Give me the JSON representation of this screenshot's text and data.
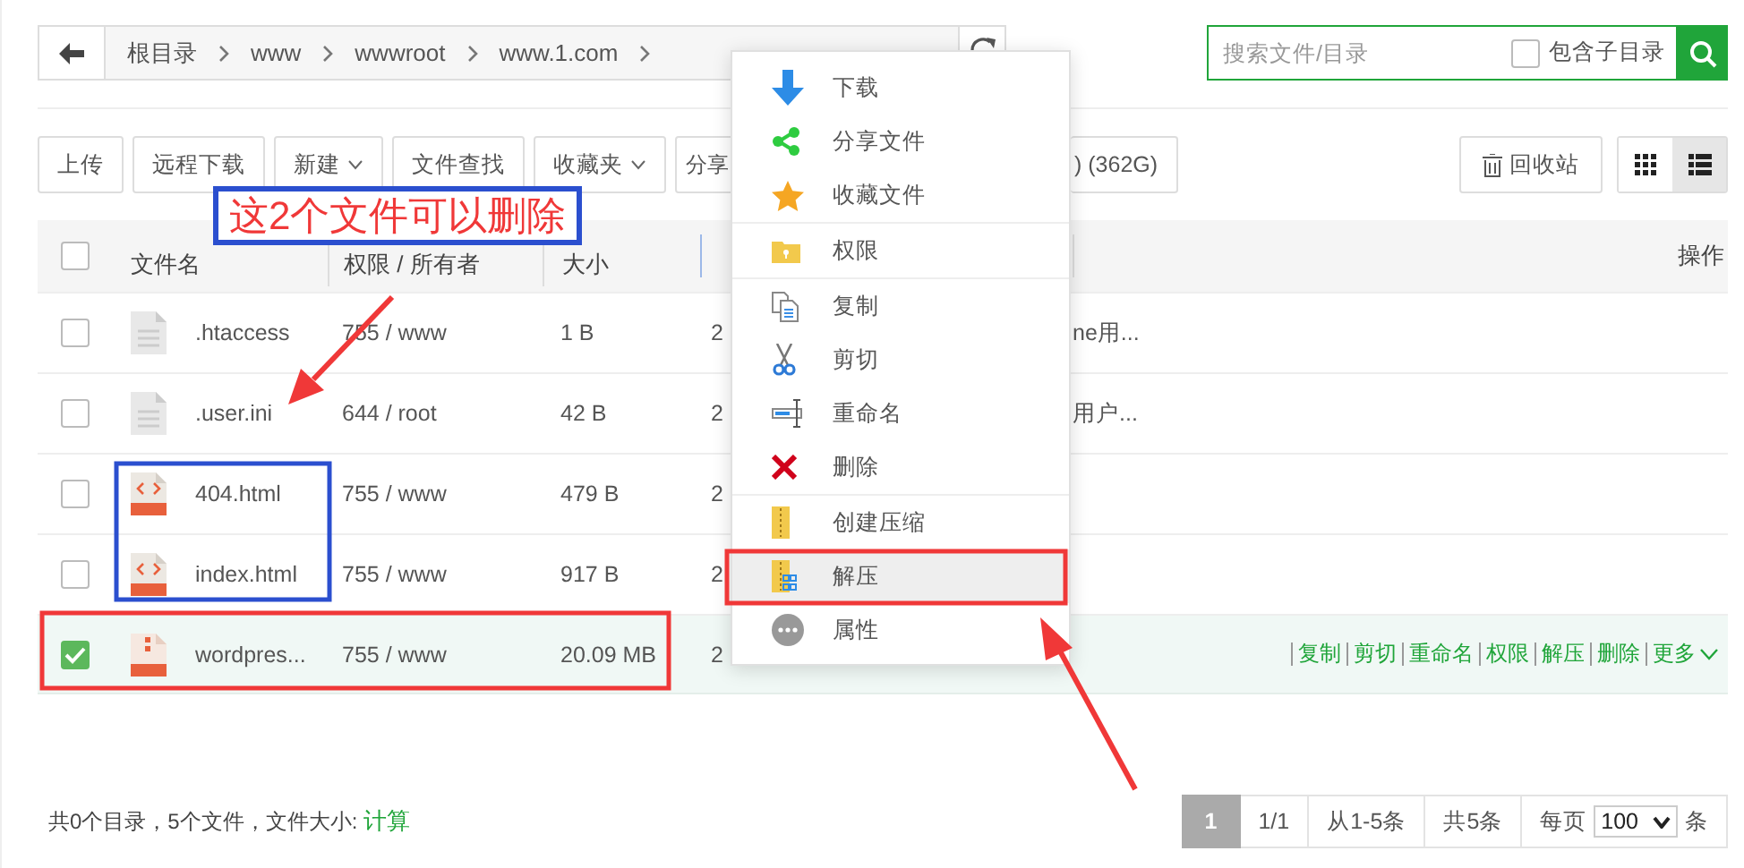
{
  "path_bar": {
    "crumbs": [
      "根目录",
      "www",
      "wwwroot",
      "www.1.com"
    ]
  },
  "search": {
    "placeholder": "搜索文件/目录",
    "include_subdirs": {
      "label": "包含子目录",
      "checked": false
    }
  },
  "toolbar": {
    "buttons": [
      {
        "label": "上传",
        "dropdown": false
      },
      {
        "label": "远程下载",
        "dropdown": false
      },
      {
        "label": "新建",
        "dropdown": true
      },
      {
        "label": "文件查找",
        "dropdown": false
      },
      {
        "label": "收藏夹",
        "dropdown": true
      },
      {
        "label": "分享",
        "dropdown": false
      }
    ],
    "disk": ") (362G)",
    "recycle": "回收站",
    "views": [
      {
        "selected": false
      },
      {
        "selected": true
      }
    ]
  },
  "table": {
    "select_all": {
      "checked": false
    },
    "columns": [
      "文件名",
      "权限 / 所有者",
      "大小",
      "操作"
    ],
    "rows": [
      {
        "kind": "doc",
        "name": ".htaccess",
        "perm": "755 / www",
        "size": "1 B",
        "date": "2",
        "note": "ne用...",
        "selected": false
      },
      {
        "kind": "doc",
        "name": ".user.ini",
        "perm": "644 / root",
        "size": "42 B",
        "date": "2",
        "note": "用户...",
        "selected": false
      },
      {
        "kind": "html",
        "name": "404.html",
        "perm": "755 / www",
        "size": "479 B",
        "date": "2",
        "selected": false
      },
      {
        "kind": "html",
        "name": "index.html",
        "perm": "755 / www",
        "size": "917 B",
        "date": "2",
        "selected": false
      },
      {
        "kind": "zip",
        "name": "wordpres...",
        "perm": "755 / www",
        "size": "20.09 MB",
        "date": "2",
        "selected": true,
        "actions": [
          "复制",
          "剪切",
          "重命名",
          "权限",
          "解压",
          "删除",
          "更多"
        ]
      }
    ]
  },
  "footer": {
    "summary": "共0个目录，5个文件，文件大小: ",
    "calc_link": "计算",
    "pages": [
      {
        "label": "1",
        "selected": true
      },
      {
        "label": "1/1",
        "selected": false
      }
    ],
    "range": "从1-5条",
    "total": "共5条",
    "per_page": "每页",
    "per_page_value": "100",
    "unit": "条"
  },
  "context_menu": {
    "items": [
      {
        "label": "下载",
        "divider_before": false,
        "selected": false
      },
      {
        "label": "分享文件",
        "divider_before": false,
        "selected": false
      },
      {
        "label": "收藏文件",
        "divider_before": false,
        "selected": false
      },
      {
        "label": "权限",
        "divider_before": true,
        "selected": false
      },
      {
        "label": "复制",
        "divider_before": true,
        "selected": false
      },
      {
        "label": "剪切",
        "divider_before": false,
        "selected": false
      },
      {
        "label": "重命名",
        "divider_before": false,
        "selected": false
      },
      {
        "label": "删除",
        "divider_before": false,
        "selected": false
      },
      {
        "label": "创建压缩",
        "divider_before": true,
        "selected": false
      },
      {
        "label": "解压",
        "divider_before": false,
        "selected": true
      },
      {
        "label": "属性",
        "divider_before": false,
        "selected": false
      }
    ]
  },
  "annotation": {
    "label": "这2个文件可以删除"
  }
}
